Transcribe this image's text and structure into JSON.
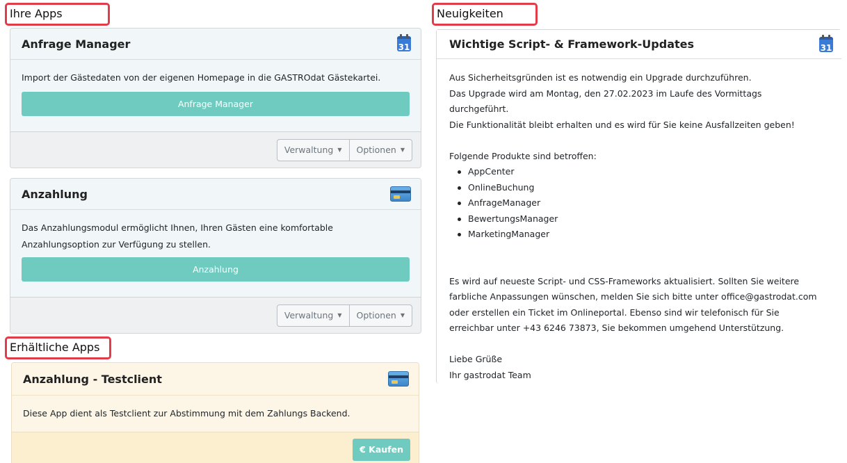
{
  "sections": {
    "your_apps": "Ihre Apps",
    "news": "Neuigkeiten",
    "available_apps": "Erhältliche Apps"
  },
  "apps": [
    {
      "title": "Anfrage Manager",
      "icon": "calendar-icon",
      "icon_text": "31",
      "description": "Import der Gästedaten von der eigenen Homepage in die GASTROdat Gästekartei.",
      "button": "Anfrage Manager",
      "menu_admin": "Verwaltung",
      "menu_options": "Optionen"
    },
    {
      "title": "Anzahlung",
      "icon": "credit-card-icon",
      "description": "Das Anzahlungsmodul ermöglicht Ihnen, Ihren Gästen eine komfortable Anzahlungsoption zur Verfügung zu stellen.",
      "button": "Anzahlung",
      "menu_admin": "Verwaltung",
      "menu_options": "Optionen"
    }
  ],
  "available": [
    {
      "title": "Anzahlung - Testclient",
      "icon": "credit-card-icon",
      "description": "Diese App dient als Testclient zur Abstimmung mit dem Zahlungs Backend.",
      "buy_button": "€ Kaufen"
    }
  ],
  "news": {
    "title": "Wichtige Script- & Framework-Updates",
    "icon": "calendar-icon",
    "icon_text": "31",
    "lines": [
      "Aus Sicherheitsgründen ist es notwendig ein Upgrade durchzuführen.",
      "Das Upgrade wird am Montag, den 27.02.2023 im Laufe des Vormittags",
      "durchgeführt.",
      "Die Funktionalität bleibt erhalten und es wird für Sie keine Ausfallzeiten geben!"
    ],
    "products_intro": "Folgende Produkte sind betroffen:",
    "products": [
      "AppCenter",
      "OnlineBuchung",
      "AnfrageManager",
      "BewertungsManager",
      "MarketingManager"
    ],
    "paragraph": [
      "Es wird auf neueste Script- und CSS-Frameworks aktualisiert. Sollten Sie weitere",
      "farbliche Anpassungen wünschen, melden Sie sich bitte unter office@gastrodat.com",
      "oder erstellen ein Ticket im Onlineportal. Ebenso sind wir telefonisch für Sie",
      "erreichbar unter +43 6246 73873, Sie bekommen umgehend Unterstützung."
    ],
    "greeting": "Liebe Grüße",
    "signature": "Ihr gastrodat Team"
  },
  "colors": {
    "highlight_border": "#e03c4a",
    "primary_button": "#6fcbbf",
    "app_card_bg": "#f1f7f8",
    "available_card_bg": "#fdf6e6"
  }
}
